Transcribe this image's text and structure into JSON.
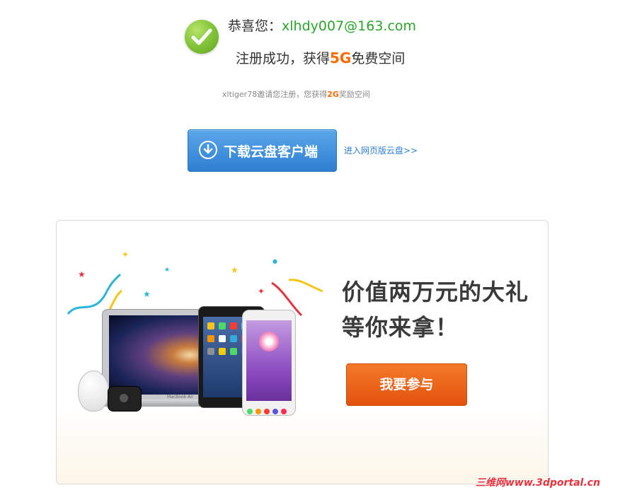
{
  "header": {
    "congrats_prefix": "恭喜您：",
    "email": "xlhdy007@163.com",
    "success_prefix": "注册成功，获得",
    "success_amount": "5G",
    "success_suffix": "免费空间",
    "invite_prefix": "xltiger78邀请您注册，您获得",
    "invite_amount": "2G",
    "invite_suffix": "奖励空间"
  },
  "actions": {
    "download_label": "下载云盘客户端",
    "web_link": "进入网页版云盘>>"
  },
  "promo": {
    "title_line1": "价值两万元的大礼",
    "title_line2": "等你来拿！",
    "join_label": "我要参与",
    "laptop_brand": "MacBook Air"
  },
  "watermark": "三维网www.3dportal.cn",
  "colors": {
    "success_green": "#2aa52a",
    "highlight_orange": "#ff6a00",
    "download_blue": "#2e7fd2",
    "join_orange": "#e2520d"
  }
}
